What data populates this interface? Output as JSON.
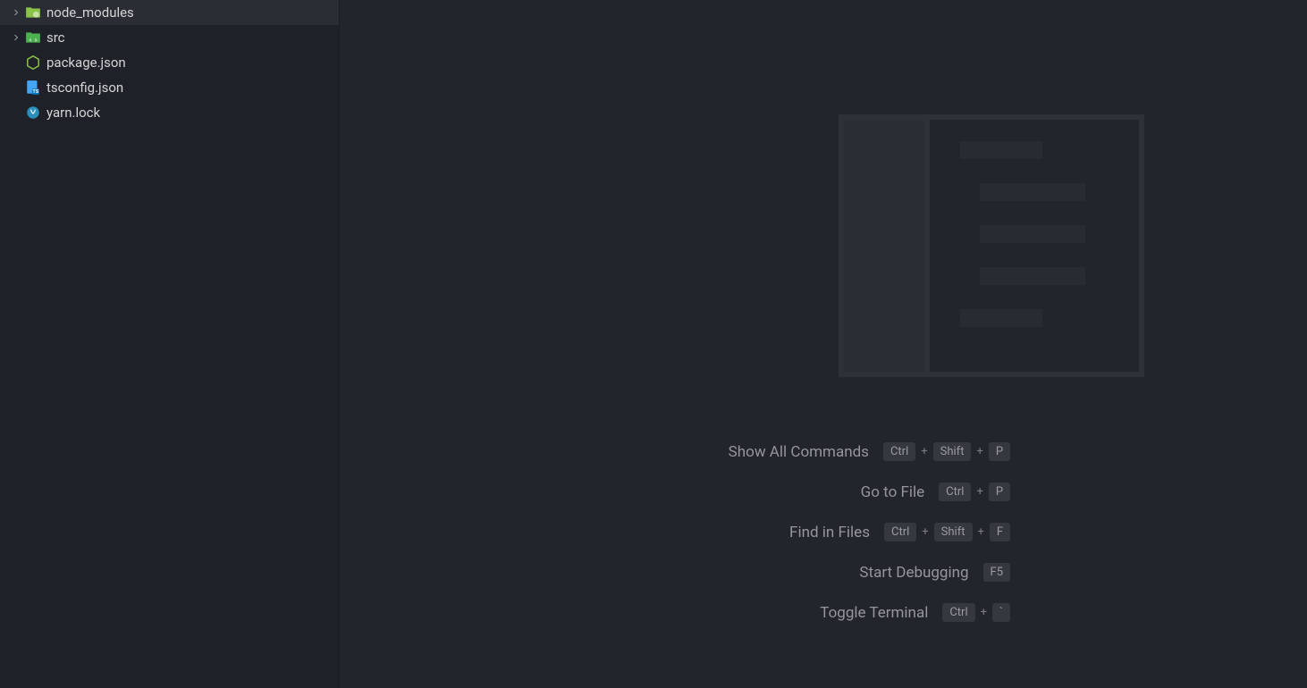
{
  "sidebar": {
    "items": [
      {
        "name": "node_modules",
        "type": "folder",
        "expandable": true,
        "iconColor": "#7fb95f",
        "iconBadge": "npm"
      },
      {
        "name": "src",
        "type": "folder",
        "expandable": true,
        "iconColor": "#43a047"
      },
      {
        "name": "package.json",
        "type": "file",
        "expandable": false,
        "iconType": "nodejs"
      },
      {
        "name": "tsconfig.json",
        "type": "file",
        "expandable": false,
        "iconType": "tsconfig"
      },
      {
        "name": "yarn.lock",
        "type": "file",
        "expandable": false,
        "iconType": "yarn"
      }
    ]
  },
  "shortcuts": [
    {
      "label": "Show All Commands",
      "keys": [
        "Ctrl",
        "Shift",
        "P"
      ]
    },
    {
      "label": "Go to File",
      "keys": [
        "Ctrl",
        "P"
      ]
    },
    {
      "label": "Find in Files",
      "keys": [
        "Ctrl",
        "Shift",
        "F"
      ]
    },
    {
      "label": "Start Debugging",
      "keys": [
        "F5"
      ]
    },
    {
      "label": "Toggle Terminal",
      "keys": [
        "Ctrl",
        "`"
      ]
    }
  ],
  "separator": "+"
}
